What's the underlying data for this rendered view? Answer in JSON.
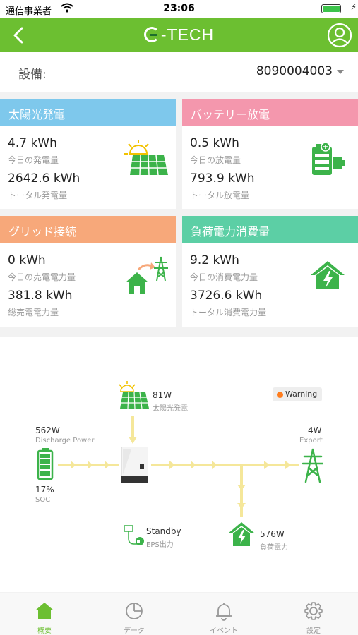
{
  "status_bar": {
    "carrier": "通信事業者",
    "time": "23:06"
  },
  "header": {
    "brand": "-TECH"
  },
  "device": {
    "label": "設備:",
    "value": "8090004003"
  },
  "cards": {
    "solar": {
      "title": "太陽光発電",
      "value1": "4.7 kWh",
      "label1": "今日の発電量",
      "value2": "2642.6 kWh",
      "label2": "トータル発電量",
      "color": "#7ec8ec"
    },
    "battery": {
      "title": "バッテリー放電",
      "value1": "0.5 kWh",
      "label1": "今日の放電量",
      "value2": "793.9 kWh",
      "label2": "トータル放電量",
      "color": "#f497ad"
    },
    "grid": {
      "title": "グリッド接続",
      "value1": "0 kWh",
      "label1": "今日の売電電力量",
      "value2": "381.8 kWh",
      "label2": "総売電電力量",
      "color": "#f7a87a"
    },
    "load": {
      "title": "負荷電力消費量",
      "value1": "9.2 kWh",
      "label1": "今日の消費電力量",
      "value2": "3726.6 kWh",
      "label2": "トータル消費電力量",
      "color": "#5ccfa5"
    }
  },
  "flow": {
    "warning": "Warning",
    "pv": {
      "value": "81W",
      "label": "太陽光発電"
    },
    "battery": {
      "value": "562W",
      "label": "Discharge Power",
      "soc": "17%",
      "soc_label": "SOC"
    },
    "grid": {
      "value": "4W",
      "label": "Export"
    },
    "eps": {
      "value": "Standby",
      "label": "EPS出力"
    },
    "load": {
      "value": "576W",
      "label": "負荷電力"
    }
  },
  "tabs": [
    {
      "label": "概要",
      "icon": "home-icon",
      "active": true
    },
    {
      "label": "データ",
      "icon": "pie-chart-icon",
      "active": false
    },
    {
      "label": "イベント",
      "icon": "bell-icon",
      "active": false
    },
    {
      "label": "設定",
      "icon": "gear-icon",
      "active": false
    }
  ],
  "colors": {
    "accent": "#6cbf31",
    "icon_green": "#3cb34a",
    "flow_arrow": "#f5e79a",
    "warning_dot": "#ff7d1e"
  }
}
